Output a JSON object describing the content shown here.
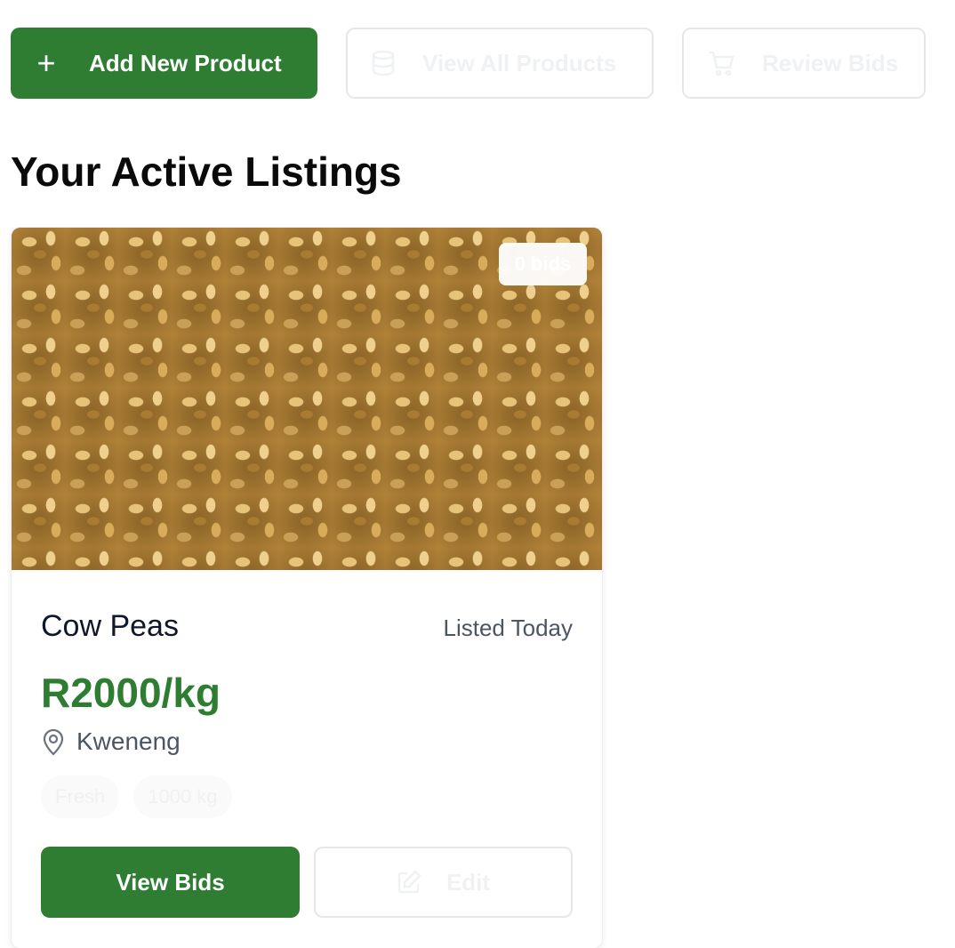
{
  "toolbar": {
    "add_product_label": "Add New Product",
    "view_products_label": "View All Products",
    "review_bids_label": "Review Bids"
  },
  "section": {
    "title": "Your Active Listings"
  },
  "listing": {
    "bids_badge": "0 bids",
    "name": "Cow Peas",
    "listed": "Listed Today",
    "price": "R2000/kg",
    "location": "Kweneng",
    "tags": [
      "Fresh",
      "1000 kg"
    ],
    "view_bids_label": "View Bids",
    "edit_label": "Edit",
    "image_icon": "wheat-grain-photo"
  },
  "colors": {
    "primary": "#2e7d32",
    "muted_text": "#4b5563",
    "border": "#e5e7eb"
  }
}
